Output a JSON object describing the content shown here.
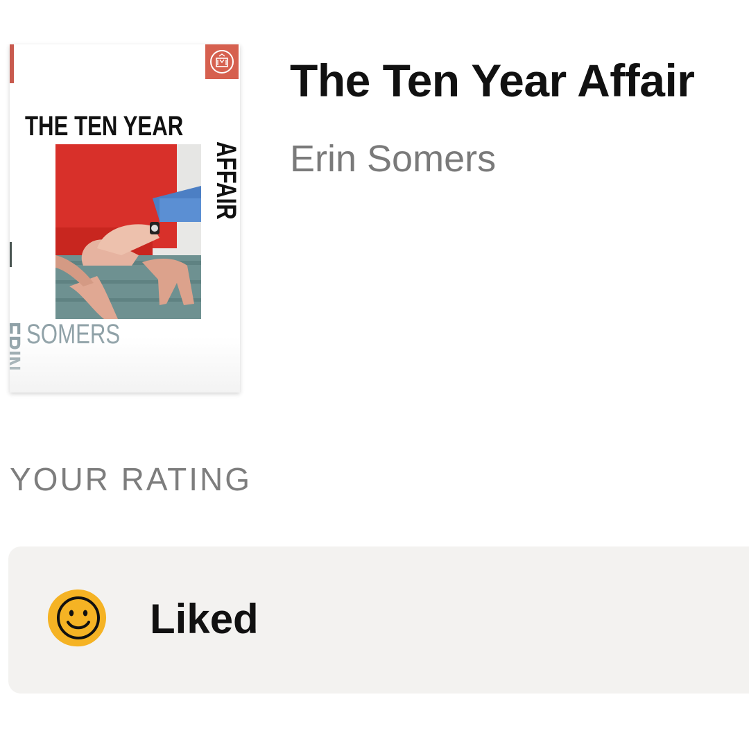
{
  "book": {
    "title": "The Ten Year Affair",
    "author": "Erin Somers",
    "cover": {
      "title_line": "THE TEN YEAR",
      "title_vertical": "AFFAIR",
      "author_first": "ERIN",
      "author_last": "SOMERS"
    }
  },
  "rating": {
    "section_label": "YOUR RATING",
    "value": "Liked",
    "icon": "smiley-icon",
    "icon_color": "#f5b324"
  }
}
